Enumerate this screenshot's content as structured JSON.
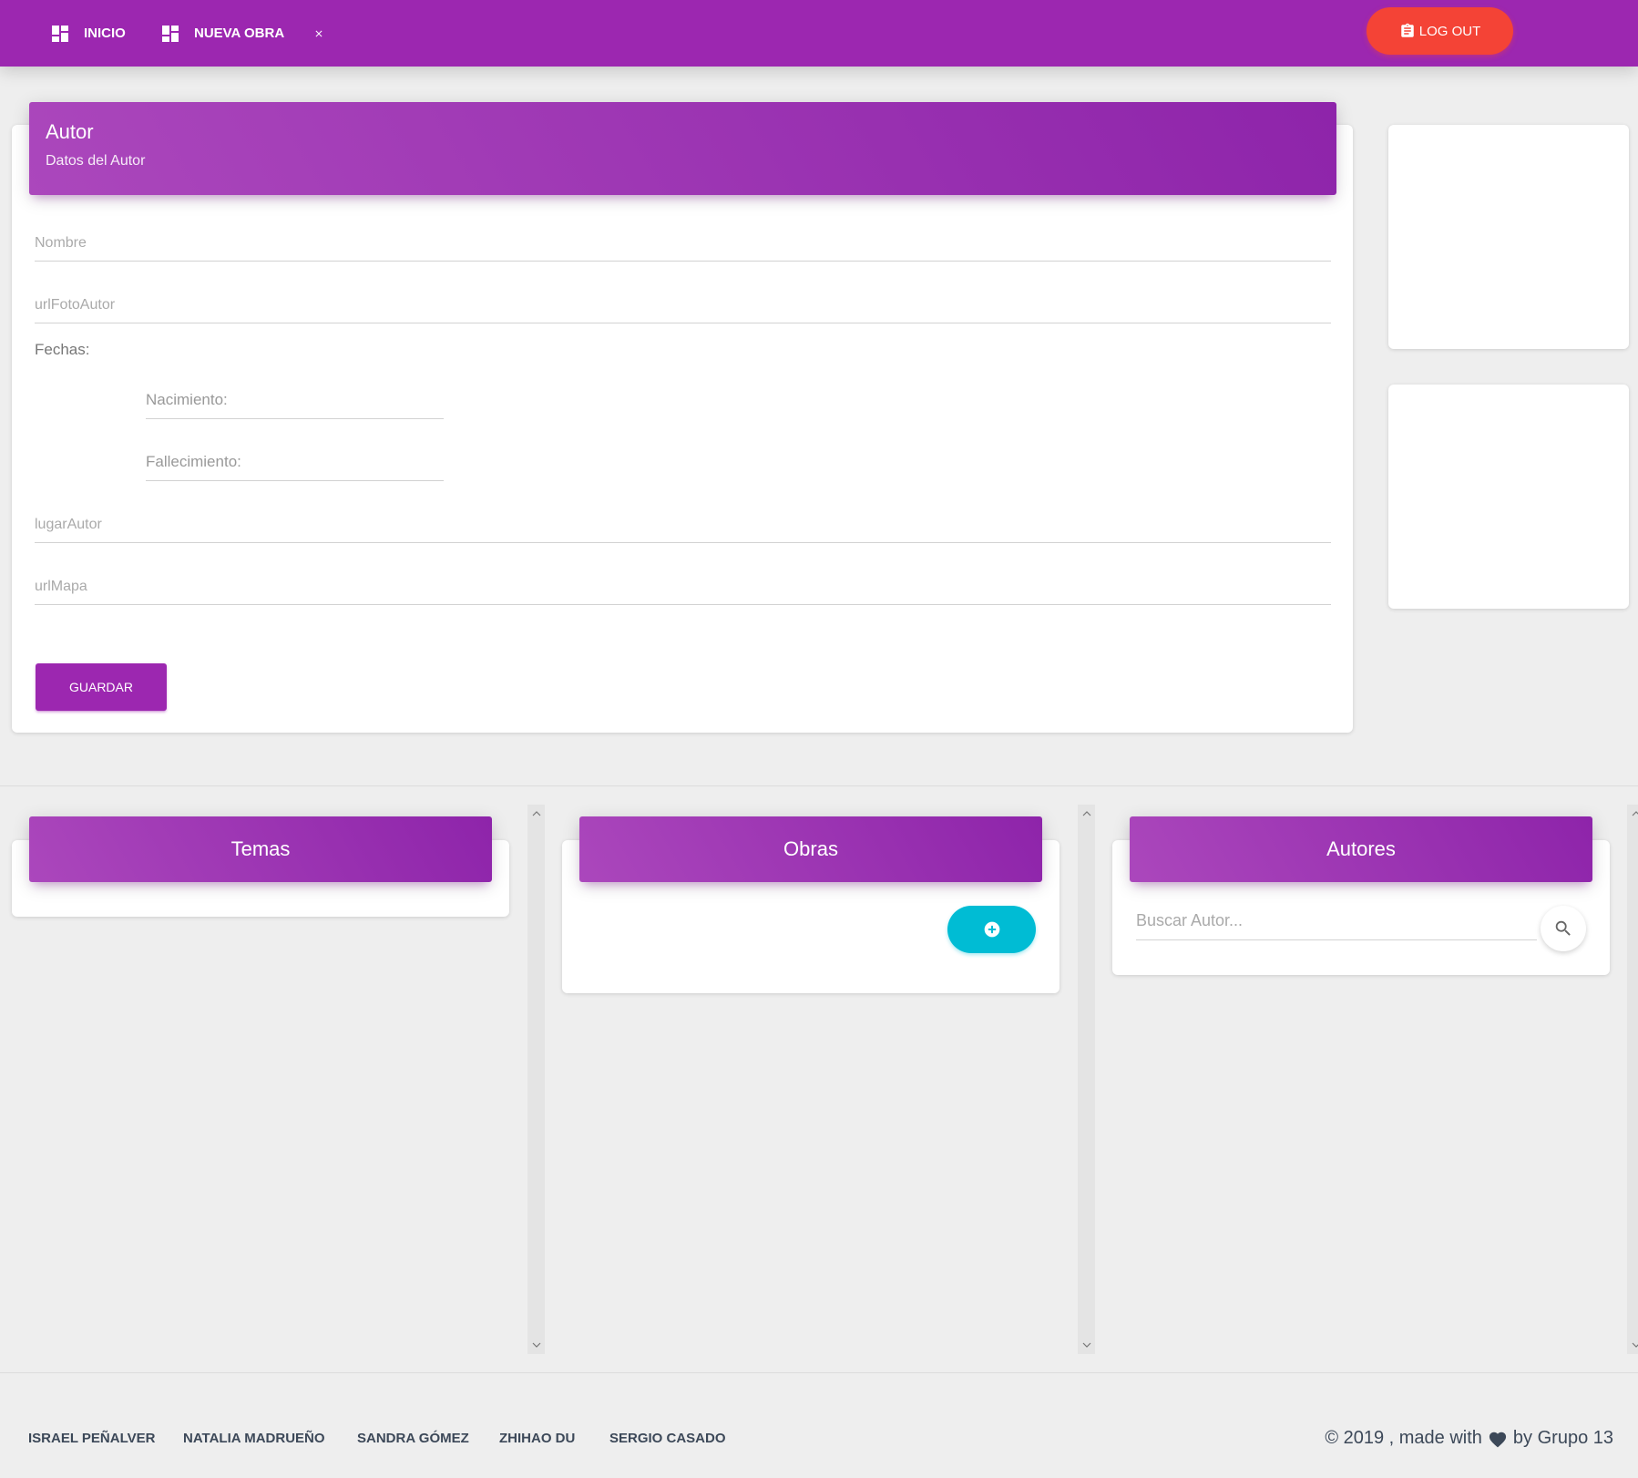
{
  "navbar": {
    "inicio_label": "INICIO",
    "nueva_obra_label": "NUEVA OBRA",
    "logout_label": "LOG OUT",
    "bg_color": "#9c27b0",
    "logout_color": "#f44336"
  },
  "autor_form": {
    "title": "Autor",
    "subtitle": "Datos del Autor",
    "nombre_placeholder": "Nombre",
    "url_foto_placeholder": "urlFotoAutor",
    "fechas_label": "Fechas:",
    "nacimiento_placeholder": "Nacimiento:",
    "fallecimiento_placeholder": "Fallecimiento:",
    "lugar_placeholder": "lugarAutor",
    "url_mapa_placeholder": "urlMapa",
    "guardar_label": "GUARDAR"
  },
  "columns": {
    "temas_title": "Temas",
    "obras_title": "Obras",
    "autores_title": "Autores",
    "buscar_placeholder": "Buscar Autor...",
    "add_button_color": "#00bcd4"
  },
  "footer": {
    "links": [
      "ISRAEL PEÑALVER",
      "NATALIA MADRUEÑO",
      "SANDRA GÓMEZ",
      "ZHIHAO DU",
      "SERGIO CASADO"
    ],
    "copyright_prefix": "© 2019 , made with",
    "copyright_suffix": "by Grupo 13"
  },
  "icons": {
    "inicio": "dashboard-icon",
    "nueva_obra": "dashboard-icon",
    "close": "close-icon",
    "logout": "clipboard-icon",
    "add": "add-circle-icon",
    "search": "search-icon",
    "heart": "heart-icon"
  }
}
